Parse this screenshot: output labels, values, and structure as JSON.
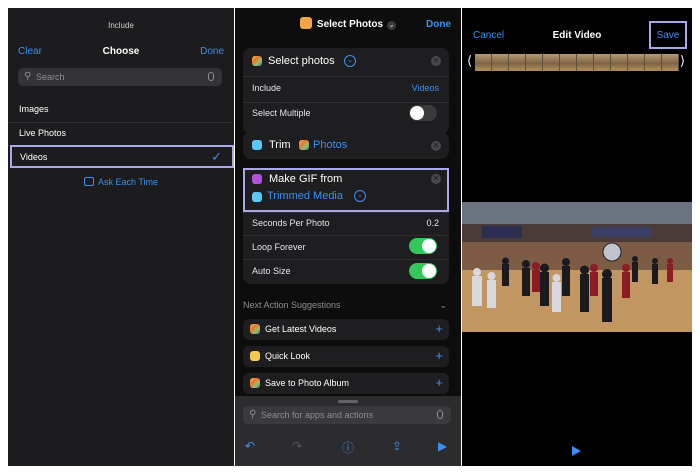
{
  "panel_choose": {
    "title": "Include",
    "clear": "Clear",
    "header": "Choose",
    "done": "Done",
    "search_placeholder": "Search",
    "options": [
      "Images",
      "Live Photos",
      "Videos"
    ],
    "selected": "Videos",
    "ask_each_time": "Ask Each Time"
  },
  "panel_shortcut": {
    "title": "Select Photos",
    "done": "Done",
    "select_photos": {
      "title": "Select photos",
      "include_label": "Include",
      "include_value": "Videos",
      "select_multiple_label": "Select Multiple",
      "select_multiple_on": false
    },
    "trim": {
      "verb": "Trim",
      "target": "Photos"
    },
    "make_gif": {
      "title": "Make GIF from",
      "source": "Trimmed Media",
      "seconds_label": "Seconds Per Photo",
      "seconds_value": "0.2",
      "loop_label": "Loop Forever",
      "loop_on": true,
      "auto_size_label": "Auto Size",
      "auto_size_on": true
    },
    "suggestions_header": "Next Action Suggestions",
    "suggestions": [
      "Get Latest Videos",
      "Quick Look",
      "Save to Photo Album"
    ],
    "search_placeholder": "Search for apps and actions"
  },
  "panel_edit": {
    "cancel": "Cancel",
    "title": "Edit Video",
    "save": "Save"
  },
  "colors": {
    "accent": "#3b8ff0",
    "highlight": "#a9a8ea",
    "toggle_on": "#34c759"
  }
}
